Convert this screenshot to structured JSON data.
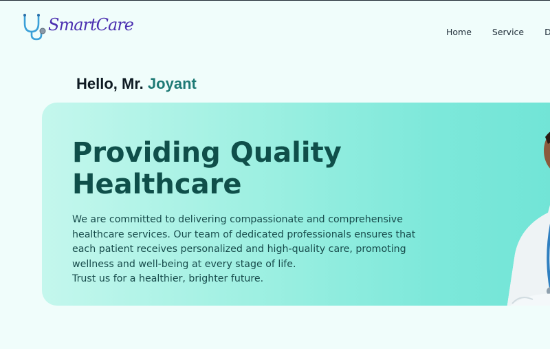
{
  "brand": {
    "name": "SmartCare",
    "icon": "stethoscope-icon",
    "color": "#4b2fb0"
  },
  "nav": {
    "items": [
      {
        "label": "Home"
      },
      {
        "label": "Service"
      },
      {
        "label": "Do"
      }
    ]
  },
  "greeting": {
    "prefix": "Hello, Mr.",
    "name": "Joyant"
  },
  "hero": {
    "title_line1": "Providing Quality",
    "title_line2": "Healthcare",
    "description": "We are committed to delivering compassionate and comprehensive healthcare services. Our team of dedicated professionals ensures that each patient receives personalized and high-quality care, promoting wellness and well-being at every stage of life.",
    "tagline": "Trust us for a healthier, brighter future.",
    "image": "doctor-photo"
  },
  "colors": {
    "accent": "#1e7a75",
    "title": "#0f4f4a",
    "background": "#f0fdfb"
  }
}
